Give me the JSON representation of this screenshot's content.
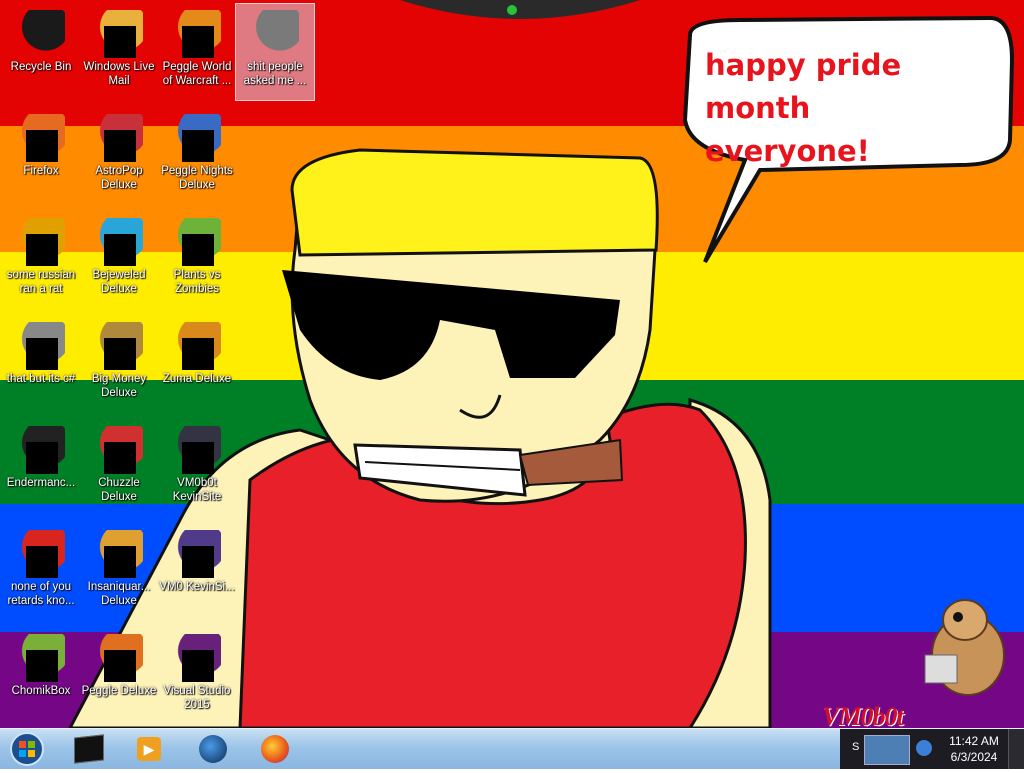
{
  "wallpaper": {
    "stripe_colors": [
      "#e40303",
      "#ff8c00",
      "#ffed00",
      "#008026",
      "#004dff",
      "#750787"
    ],
    "speech_bubble": {
      "line1": "happy pride month",
      "line2": "everyone!"
    },
    "watermark": "VM0b0t"
  },
  "desktop_icons": [
    {
      "label": "Recycle Bin",
      "icon": "recycle-bin-icon",
      "selected": false
    },
    {
      "label": "Windows Live Mail",
      "icon": "windows-live-mail-icon",
      "selected": false
    },
    {
      "label": "Peggle World of Warcraft ...",
      "icon": "peggle-wow-icon",
      "selected": false
    },
    {
      "label": "shit people asked me ...",
      "icon": "folder-icon",
      "selected": true
    },
    {
      "label": "Firefox",
      "icon": "firefox-icon",
      "selected": false
    },
    {
      "label": "AstroPop Deluxe",
      "icon": "astropop-icon",
      "selected": false
    },
    {
      "label": "Peggle Nights Deluxe",
      "icon": "peggle-nights-icon",
      "selected": false
    },
    {
      "label": "some russian ran a rat",
      "icon": "after-effects-icon",
      "selected": false
    },
    {
      "label": "Bejeweled Deluxe",
      "icon": "bejeweled-icon",
      "selected": false
    },
    {
      "label": "Plants vs Zombies",
      "icon": "plants-vs-zombies-icon",
      "selected": false
    },
    {
      "label": "that but its c#",
      "icon": "shortcut-icon",
      "selected": false
    },
    {
      "label": "Big Money Deluxe",
      "icon": "big-money-icon",
      "selected": false
    },
    {
      "label": "Zuma Deluxe",
      "icon": "zuma-icon",
      "selected": false
    },
    {
      "label": "Endermanc...",
      "icon": "terminal-icon",
      "selected": false
    },
    {
      "label": "Chuzzle Deluxe",
      "icon": "chuzzle-icon",
      "selected": false
    },
    {
      "label": "VM0b0t KevinSite",
      "icon": "kevinsite-icon",
      "selected": false
    },
    {
      "label": "none of you retards kno...",
      "icon": "opera-icon",
      "selected": false
    },
    {
      "label": "Insaniquar... Deluxe",
      "icon": "insaniquarium-icon",
      "selected": false
    },
    {
      "label": "VM0 KevinSi...",
      "icon": "kevinsite-file-icon",
      "selected": false
    },
    {
      "label": "ChomikBox",
      "icon": "chomikbox-icon",
      "selected": false
    },
    {
      "label": "Peggle Deluxe",
      "icon": "peggle-icon",
      "selected": false
    },
    {
      "label": "Visual Studio 2015",
      "icon": "visual-studio-icon",
      "selected": false
    }
  ],
  "taskbar": {
    "pinned": [
      {
        "name": "taskbar-cmd",
        "icon": "black-window-icon"
      },
      {
        "name": "taskbar-media-player",
        "icon": "media-player-icon"
      },
      {
        "name": "taskbar-app",
        "icon": "globe-icon"
      },
      {
        "name": "taskbar-firefox",
        "icon": "firefox-icon"
      }
    ],
    "tray_letter": "S",
    "clock": {
      "time": "11:42 AM",
      "date": "6/3/2024"
    }
  }
}
